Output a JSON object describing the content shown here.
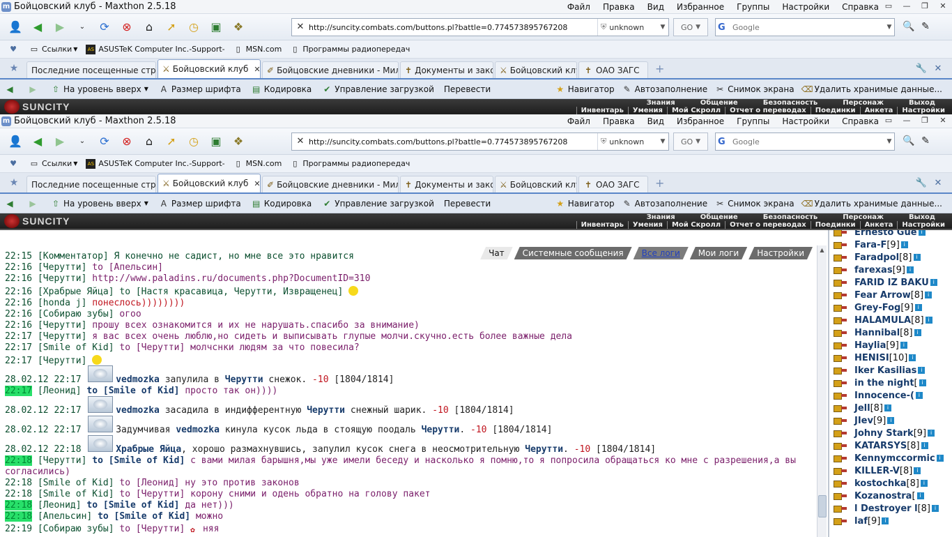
{
  "window": {
    "title": "Бойцовский клуб - Maxthon 2.5.18",
    "menus": [
      "Файл",
      "Правка",
      "Вид",
      "Избранное",
      "Группы",
      "Настройки",
      "Справка"
    ],
    "controls": [
      "▭",
      "—",
      "❐",
      "✕"
    ]
  },
  "toolbar": {
    "url": "http://suncity.combats.com/buttons.pl?battle=0.774573895767208",
    "security": "unknown",
    "go": "GO",
    "search_placeholder": "Google"
  },
  "bookmarks": [
    {
      "icon": "folder-icon",
      "label": "Ссылки"
    },
    {
      "icon": "asus-icon",
      "label": "ASUSTeK Computer Inc.-Support-"
    },
    {
      "icon": "page-icon",
      "label": "MSN.com"
    },
    {
      "icon": "page-icon",
      "label": "Программы радиопередач"
    }
  ],
  "tabs": [
    {
      "label": "Последние посещенные страницы",
      "active": false
    },
    {
      "label": "Бойцовский клуб",
      "active": true
    },
    {
      "label": "Бойцовские дневники - Милый...",
      "active": false
    },
    {
      "label": "Документы и законы",
      "active": false
    },
    {
      "label": "Бойцовский клуб.",
      "active": false
    },
    {
      "label": "ОАО ЗАГС",
      "active": false
    }
  ],
  "navbar": {
    "left": [
      "На уровень вверх",
      "Размер шрифта",
      "Кодировка",
      "Управление загрузкой",
      "Перевести"
    ],
    "right": [
      "Навигатор",
      "Автозаполнение",
      "Снимок экрана",
      "Удалить хранимые данные..."
    ]
  },
  "game": {
    "logo": "SUNCITY",
    "menu1": [
      "Знания",
      "Общение",
      "Безопасность",
      "Персонаж",
      "Выход"
    ],
    "menu2": [
      "Инвентарь",
      "Умения",
      "Мой Скролл",
      "Отчет о переводах",
      "Поединки",
      "Анкета",
      "Настройки"
    ]
  },
  "chat_tabs": [
    "Чат",
    "Системные сообщения",
    "Все логи",
    "Мои логи",
    "Настройки"
  ],
  "messages": [
    {
      "time": "22:15",
      "nick": "Комментатор",
      "text": "Я конечно не садист, но мне все это нравится",
      "cls": "gr"
    },
    {
      "time": "22:16",
      "nick": "Черутти",
      "text": "to [Апельсин]",
      "cls": ""
    },
    {
      "time": "22:16",
      "nick": "Черутти",
      "text": "http://www.paladins.ru/documents.php?DocumentID=310",
      "cls": ""
    },
    {
      "time": "22:16",
      "nick": "Храбрые Яйца",
      "text": "to [Настя красавица, Черутти, Извращенец]",
      "cls": "gr"
    },
    {
      "time": "22:16",
      "nick": "honda j",
      "text": "понеслось))))))))",
      "cls": "red"
    },
    {
      "time": "22:16",
      "nick": "Собираю зубы",
      "text": "огоо",
      "cls": ""
    },
    {
      "time": "22:16",
      "nick": "Черутти",
      "text": "прошу всех ознакомится и их не нарушать.спасибо за внимание)",
      "cls": ""
    },
    {
      "time": "22:17",
      "nick": "Черутти",
      "text": "я вас всех очень люблю,но сидеть и выписывать глупые молчи.скучно.есть более важные дела",
      "cls": ""
    },
    {
      "time": "22:17",
      "nick": "Smile of Kid",
      "text": "to [Черутти] молчснки людям за что повесила?",
      "cls": ""
    },
    {
      "time": "22:17",
      "nick": "Черутти",
      "text": "",
      "cls": ""
    }
  ],
  "events": [
    {
      "date": "28.02.12 22:17",
      "a": "vedmozka",
      "verb": "запулила в",
      "b": "Черутти",
      "tail": "снежок.",
      "dmg": "-10",
      "hp": "[1804/1814]"
    },
    {
      "date": "28.02.12 22:17",
      "a": "vedmozka",
      "verb": "засадила в индифферентную",
      "b": "Черутти",
      "tail": "снежный шарик.",
      "dmg": "-10",
      "hp": "[1804/1814]"
    },
    {
      "date": "28.02.12 22:17",
      "a": "vedmozka",
      "verb": "кинула кусок льда в стоящую поодаль",
      "b": "Черутти",
      "tail": ".",
      "dmg": "-10",
      "hp": "[1804/1814]",
      "pre": "Задумчивая"
    },
    {
      "date": "28.02.12 22:18",
      "a": "Храбрые Яйца",
      "verb": ", хорошо размахнувшись, запулил кусок снега в неосмотрительную",
      "b": "Черутти",
      "tail": ".",
      "dmg": "-10",
      "hp": "[1804/1814]"
    }
  ],
  "messages2": [
    {
      "time": "22:17",
      "nick": "Леонид",
      "to": "to [Smile of Kid]",
      "text": "просто так он))))",
      "hl": true
    },
    {
      "time": "22:18",
      "nick": "Черутти",
      "to": "to [Smile of Kid]",
      "text": "с вами милая барышня,мы уже имели беседу и насколько я помню,то я попросила обращаться ко мне с разрешения,а вы",
      "hl": true
    },
    {
      "time": "",
      "nick": "",
      "to": "",
      "text": "согласились)",
      "hl": false
    },
    {
      "time": "22:18",
      "nick": "Smile of Kid",
      "to": "to [Леонид]",
      "text": "ну это против законов",
      "hl": false
    },
    {
      "time": "22:18",
      "nick": "Smile of Kid",
      "to": "to [Черутти]",
      "text": "корону сними и одень обратно на голову пакет",
      "hl": false
    },
    {
      "time": "22:18",
      "nick": "Леонид",
      "to": "to [Smile of Kid]",
      "text": "да нет)))",
      "hl": true
    },
    {
      "time": "22:18",
      "nick": "Апельсин",
      "to": "to [Smile of Kid]",
      "text": "можно",
      "hl": true
    },
    {
      "time": "22:19",
      "nick": "Собираю зубы",
      "to": "to [Черутти]",
      "text": "няя",
      "hl": false
    }
  ],
  "users": [
    {
      "name": "Ernesto Gue",
      "lvl": ""
    },
    {
      "name": "Fara-F",
      "lvl": "[9]"
    },
    {
      "name": "Faradpol",
      "lvl": "[8]"
    },
    {
      "name": "farexas",
      "lvl": "[9]"
    },
    {
      "name": "FARID IZ BAKU",
      "lvl": ""
    },
    {
      "name": "Fear Arrow",
      "lvl": "[8]"
    },
    {
      "name": "Grey-Fog",
      "lvl": "[9]"
    },
    {
      "name": "HALAMULA",
      "lvl": "[8]"
    },
    {
      "name": "Hannibal",
      "lvl": "[8]"
    },
    {
      "name": "Haylia",
      "lvl": "[9]"
    },
    {
      "name": "HENISI",
      "lvl": "[10]"
    },
    {
      "name": "Iker Kasilias",
      "lvl": ""
    },
    {
      "name": "in the night",
      "lvl": "["
    },
    {
      "name": "Innocence-(",
      "lvl": ""
    },
    {
      "name": "Jell",
      "lvl": "[8]"
    },
    {
      "name": "JIev",
      "lvl": "[9]"
    },
    {
      "name": "Johny Stark",
      "lvl": "[9]"
    },
    {
      "name": "KATARSYS",
      "lvl": "[8]"
    },
    {
      "name": "Kennymccormic",
      "lvl": ""
    },
    {
      "name": "KILLER-V",
      "lvl": "[8]"
    },
    {
      "name": "kostochka",
      "lvl": "[8]"
    },
    {
      "name": "Kozanostra",
      "lvl": "["
    },
    {
      "name": "l Destroyer l",
      "lvl": "[8]"
    },
    {
      "name": "laf",
      "lvl": "[9]"
    }
  ]
}
